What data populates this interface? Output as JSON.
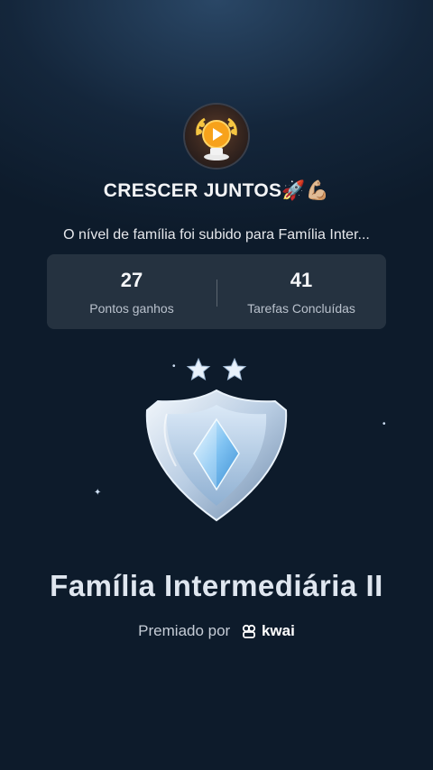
{
  "avatar": {
    "icon": "play-trophy-icon"
  },
  "header": {
    "title": "CRESCER JUNTOS🚀💪🏼"
  },
  "message": {
    "text": "O nível de família foi subido para Família Inter..."
  },
  "stats": [
    {
      "value": "27",
      "label": "Pontos ganhos"
    },
    {
      "value": "41",
      "label": "Tarefas Concluídas"
    }
  ],
  "badge": {
    "stars": 2,
    "icon": "silver-shield-crystal-icon"
  },
  "rank": {
    "title": "Família Intermediária II"
  },
  "awarded": {
    "prefix": "Premiado por",
    "brand": "kwai"
  },
  "colors": {
    "background": "#14263b",
    "card": "#2a3645",
    "text": "#ffffff"
  }
}
